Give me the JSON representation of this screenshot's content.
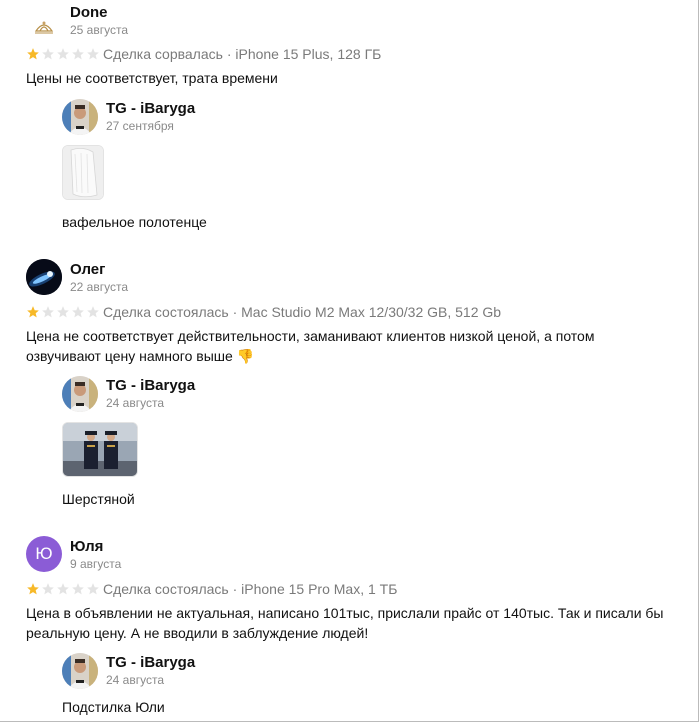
{
  "colors": {
    "star_filled": "#f7b928",
    "star_empty": "#e3e3e3",
    "muted": "#8a8a8a",
    "violet_avatar": "#8b5cd6"
  },
  "reviews": [
    {
      "author": "Done",
      "date": "25 августа",
      "rating": 1,
      "meta": "Сделка сорвалась · iPhone 15 Plus, 128 ГБ",
      "text": "Цены не соответствует, трата времени",
      "avatar_icon": "lotus-logo-icon",
      "reply": {
        "author": "TG - iBaryga",
        "date": "27 сентября",
        "photo_icon": "towel-photo",
        "text": "вафельное полотенце"
      }
    },
    {
      "author": "Олег",
      "date": "22 августа",
      "rating": 1,
      "meta": "Сделка состоялась · Mac Studio M2 Max 12/30/32 GB, 512 Gb",
      "text": "Цена не соответствует действительности, заманивают клиентов низкой ценой, а потом озвучивают цену намного выше 👎",
      "avatar_icon": "comet-icon",
      "reply": {
        "author": "TG - iBaryga",
        "date": "24 августа",
        "photo_icon": "officers-photo",
        "text": "Шерстяной"
      }
    },
    {
      "author": "Юля",
      "date": "9 августа",
      "rating": 1,
      "meta": "Сделка состоялась · iPhone 15 Pro Max, 1 ТБ",
      "text": "Цена в объявлении не актуальная, написано 101тыс, прислали прайс от 140тыс. Так и писали бы реальную цену. А не вводили в заблуждение людей!",
      "avatar_letter": "Ю",
      "reply": {
        "author": "TG - iBaryga",
        "date": "24 августа",
        "text": "Подстилка Юли"
      }
    }
  ]
}
